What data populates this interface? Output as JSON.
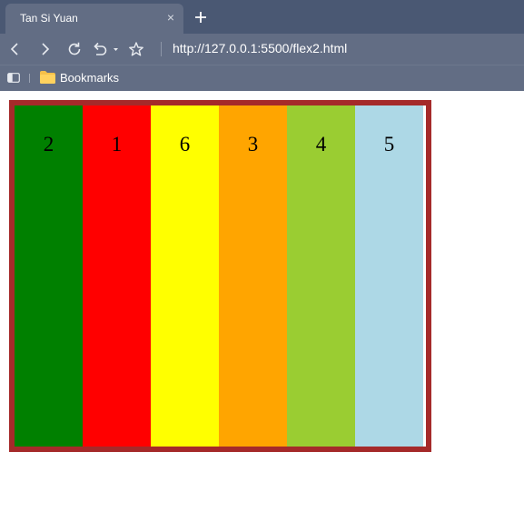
{
  "tab": {
    "title": "Tan Si Yuan",
    "close_glyph": "×"
  },
  "toolbar": {
    "url": "http://127.0.0.1:5500/flex2.html"
  },
  "bookmarks": {
    "label": "Bookmarks"
  },
  "colors": {
    "tabstrip": "#4a5873",
    "toolbar": "#626d84",
    "container_border": "#a52a2a"
  },
  "icons": {
    "new_tab": "plus-icon",
    "back": "back-arrow-icon",
    "forward": "forward-arrow-icon",
    "reload": "reload-icon",
    "undo": "undo-icon",
    "bookmark_star": "star-icon",
    "sidebar": "sidebar-toggle-icon",
    "folder": "folder-icon"
  },
  "flex_items": [
    {
      "label": "2",
      "color": "#008000"
    },
    {
      "label": "1",
      "color": "#ff0000"
    },
    {
      "label": "6",
      "color": "#ffff00"
    },
    {
      "label": "3",
      "color": "#ffa500"
    },
    {
      "label": "4",
      "color": "#9acd32"
    },
    {
      "label": "5",
      "color": "#add8e6"
    }
  ]
}
